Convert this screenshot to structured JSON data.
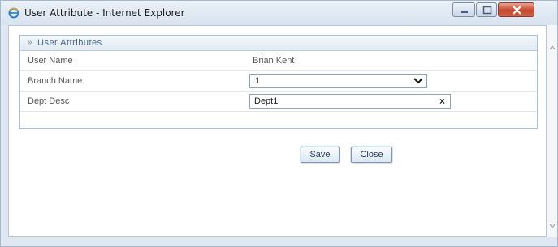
{
  "window": {
    "title": "User Attribute - Internet Explorer"
  },
  "panel": {
    "title": "User Attributes",
    "chevron": "»"
  },
  "fields": {
    "user_name": {
      "label": "User Name",
      "value": "Brian Kent"
    },
    "branch_name": {
      "label": "Branch Name",
      "selected": "1"
    },
    "dept_desc": {
      "label": "Dept Desc",
      "value": "Dept1",
      "clear": "×"
    }
  },
  "buttons": {
    "save": "Save",
    "close": "Close"
  },
  "icons": {
    "app": "internet-explorer-icon",
    "minimize": "minimize-icon",
    "maximize": "maximize-icon",
    "close": "close-icon",
    "dropdown": "chevron-down-icon",
    "scroll_up": "scroll-up-icon",
    "scroll_down": "scroll-down-icon"
  },
  "colors": {
    "panel_header_text": "#4d6a8c",
    "button_text": "#1f3f66",
    "close_button": "#c4472d"
  }
}
